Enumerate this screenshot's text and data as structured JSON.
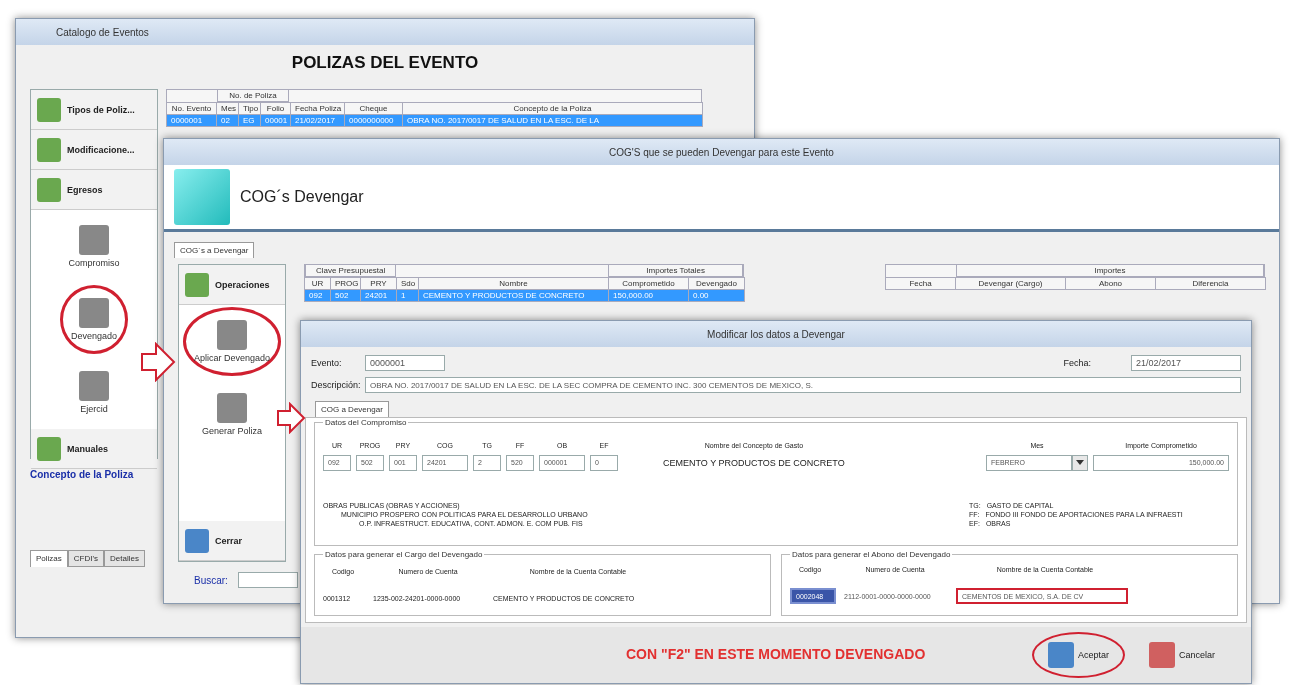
{
  "back_window": {
    "title": "Catalogo de Eventos",
    "heading": "POLIZAS DEL EVENTO",
    "columns": [
      {
        "label": "No. Evento"
      },
      {
        "label": "Mes",
        "group": "No. de Poliza"
      },
      {
        "label": "Tipo",
        "in_group": true
      },
      {
        "label": "Folio",
        "in_group": true
      },
      {
        "label": "Fecha Poliza"
      },
      {
        "label": "Cheque"
      },
      {
        "label": "Concepto de la Poliza"
      }
    ],
    "rows": [
      {
        "selected": true,
        "cells": [
          "0000001",
          "02",
          "EG",
          "00001",
          "21/02/2017",
          "0000000000",
          "OBRA NO. 2017/0017 DE SALUD EN LA ESC. DE LA"
        ]
      }
    ],
    "sidebar": [
      {
        "label": "Tipos de Poliz...",
        "kind": "header"
      },
      {
        "label": "Modificacione...",
        "kind": "header"
      },
      {
        "label": "Egresos",
        "kind": "header"
      },
      {
        "label": "Compromiso",
        "kind": "tile",
        "annotated": false
      },
      {
        "label": "Devengado",
        "kind": "tile",
        "annotated": true
      },
      {
        "label": "Ejercid",
        "kind": "tile",
        "annotated": false
      },
      {
        "label": "Manuales",
        "kind": "header"
      }
    ],
    "link": "Concepto de la Poliza",
    "tabs": [
      {
        "label": "Polizas",
        "selected": true
      },
      {
        "label": "CFDI's",
        "selected": false
      },
      {
        "label": "Detalles",
        "selected": false
      }
    ]
  },
  "middle_window": {
    "title": "COG'S que se pueden Devengar para este Evento",
    "heading": "COG´s Devengar",
    "tab": "COG´s a Devengar",
    "sidebar": [
      {
        "label": "Operaciones",
        "kind": "header"
      },
      {
        "label": "Aplicar Devengado",
        "kind": "tile",
        "annotated": true
      },
      {
        "label": "Generar Poliza",
        "kind": "tile",
        "annotated": false
      },
      {
        "label": "Cerrar",
        "kind": "footer"
      }
    ],
    "search_label": "Buscar:",
    "table": {
      "columns": [
        {
          "label": "UR",
          "group": "Clave Presupuestal"
        },
        {
          "label": "PROG",
          "in_group": true
        },
        {
          "label": "PRY",
          "in_group": true
        },
        {
          "label": "Sdo"
        },
        {
          "label": "Nombre"
        },
        {
          "label": "Comprometido",
          "group": "Importes Totales"
        },
        {
          "label": "Devengado",
          "in_group": true
        }
      ],
      "rows": [
        {
          "selected": true,
          "cells": [
            "092",
            "502",
            "24201",
            "1",
            "CEMENTO Y PRODUCTOS DE CONCRETO",
            "150,000.00",
            "0.00"
          ]
        }
      ]
    },
    "detail_table": {
      "columns": [
        {
          "label": "Fecha"
        },
        {
          "label": "Devengar (Cargo)",
          "group": "Importes"
        },
        {
          "label": "Abono",
          "in_group": true
        },
        {
          "label": "Diferencia",
          "in_group": true
        }
      ]
    }
  },
  "dialog": {
    "title": "Modificar los datos a Devengar",
    "evento_label": "Evento:",
    "evento": "0000001",
    "fecha_label": "Fecha:",
    "fecha": "21/02/2017",
    "descripcion_label": "Descripción:",
    "descripcion": "OBRA NO. 2017/0017 DE SALUD EN LA ESC. DE LA SEC COMPRA DE CEMENTO INC. 300 CEMENTOS DE MEXICO, S.",
    "tab": "COG a Devengar",
    "compromiso": {
      "title": "Datos del Compromiso",
      "fields": [
        {
          "label": "UR",
          "value": "092"
        },
        {
          "label": "PROG",
          "value": "502"
        },
        {
          "label": "PRY",
          "value": "001"
        },
        {
          "label": "COG",
          "value": "24201"
        },
        {
          "label": "TG",
          "value": "2"
        },
        {
          "label": "FF",
          "value": "520"
        },
        {
          "label": "OB",
          "value": "000001"
        },
        {
          "label": "EF",
          "value": "0"
        }
      ],
      "concepto_label": "Nombre del Concepto de Gasto",
      "concepto": "CEMENTO Y PRODUCTOS DE CONCRETO",
      "mes_label": "Mes",
      "mes": "FEBRERO",
      "importe_label": "Importe Comprometido",
      "importe": "150,000.00",
      "left_lines": [
        "OBRAS PUBLICAS (OBRAS Y ACCIONES)",
        "MUNICIPIO PROSPERO CON POLITICAS PARA EL DESARROLLO URBANO",
        "O.P. INFRAESTRUCT. EDUCATIVA, CONT. ADMON. E. COM PUB. FIS"
      ],
      "right_lines": [
        {
          "key": "TG:",
          "text": "GASTO DE CAPITAL"
        },
        {
          "key": "FF:",
          "text": "FONDO III FONDO DE APORTACIONES PARA LA INFRAESTI"
        },
        {
          "key": "EF:",
          "text": "OBRAS"
        }
      ]
    },
    "cargo": {
      "title": "Datos para generar el Cargo del Devengado",
      "columns": [
        "Codigo",
        "Numero de Cuenta",
        "Nombre de la Cuenta Contable"
      ],
      "values": [
        "0001312",
        "1235-002-24201-0000-0000",
        "CEMENTO Y PRODUCTOS DE CONCRETO"
      ]
    },
    "abono": {
      "title": "Datos para generar el Abono del Devengado",
      "columns": [
        "Codigo",
        "Numero de Cuenta",
        "Nombre de la Cuenta Contable"
      ],
      "values": [
        "0002048",
        "2112-0001-0000-0000-0000",
        "CEMENTOS DE MEXICO, S.A. DE CV"
      ]
    },
    "note": "CON \"F2\" EN ESTE MOMENTO DEVENGADO",
    "buttons": [
      {
        "label": "Aceptar",
        "kind": "accept",
        "annotated": true
      },
      {
        "label": "Cancelar",
        "kind": "cancel",
        "annotated": false
      }
    ]
  }
}
